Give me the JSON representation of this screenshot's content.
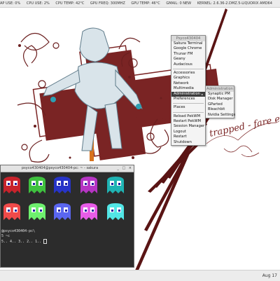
{
  "status_bar": {
    "items": [
      "AP USE: 0%",
      "CPU USE: 2%",
      "CPU TEMP: 42°C",
      "GPU FREQ: 300MHZ",
      "GPU TEMP: 46°C",
      "GMAIL: 0 NEW",
      "KERNEL: 2.6.36-2.DMZ.5-LIQUORIX AMD64"
    ]
  },
  "wallpaper": {
    "script_text": "trapped - fare ever"
  },
  "root_menu": {
    "title": "Psyco430404",
    "items": [
      "Sakura Terminal",
      "Google Chrome",
      "Thunar FM",
      "Geany",
      "Audacious",
      "Accessories",
      "Graphics",
      "Network",
      "Multimedia",
      "Administration",
      "Preferences",
      "Places",
      "Reload PekWM",
      "Restart PekWM",
      "Session Manager",
      "Logout",
      "Restart",
      "Shutdown"
    ]
  },
  "admin_menu": {
    "title": "Administration",
    "items": [
      "Synaptic PM",
      "Disk Manager",
      "GParted",
      "Bleachbit",
      "Nvidia Settings"
    ]
  },
  "terminal": {
    "title": "psyco430404@psyco430404-pc: ~ - sakura",
    "buttons": [
      "_",
      "□",
      "×"
    ],
    "lines": [
      "@psyco430404-pc\\",
      "5 ~c",
      "5.. 4.. 3.. 2.. 1.."
    ]
  },
  "taskbar": {
    "clock": "Aug 17"
  }
}
